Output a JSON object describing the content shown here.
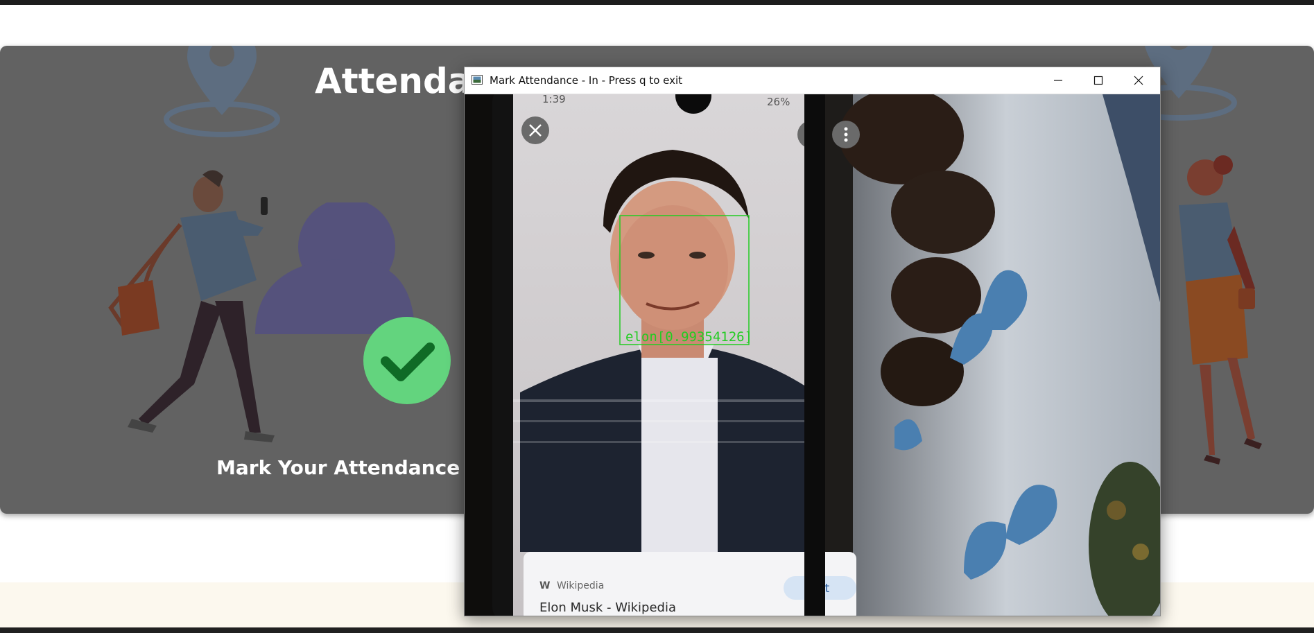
{
  "page": {
    "card_title": "Attendance",
    "card_subtitle": "Mark Your Attendance - In"
  },
  "window": {
    "title": "Mark Attendance - In - Press q to exit",
    "controls": [
      "minimize-icon",
      "maximize-icon",
      "close-icon"
    ]
  },
  "camera_feed": {
    "status_time": "1:39",
    "status_battery": "26%",
    "detection_label": "elon[0.99354126]",
    "detection_color": "#22cc22",
    "phone_source": "Wikipedia",
    "phone_link_text": "Elon Musk - Wikipedia",
    "phone_button": "Visit"
  },
  "colors": {
    "card_overlay": "#626262",
    "user_icon": "#55527c",
    "check_badge": "#63d47e",
    "check_mark": "#0f6b26"
  }
}
